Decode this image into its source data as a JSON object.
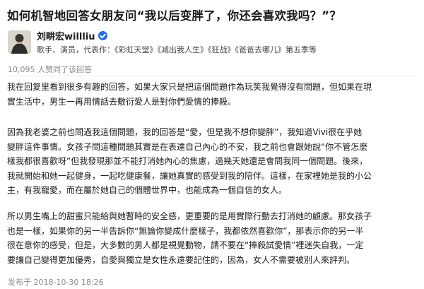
{
  "question": {
    "title": "如何机智地回答女朋友问“我以后变胖了，你还会喜欢我吗？”？"
  },
  "author": {
    "name": "刘畊宏willliu",
    "verified_icon": "verified-badge-icon",
    "bio": "歌手、演员，代表作：《彩虹天堂》《减出我人生》《狂战》《爸爸去哪儿》第五季等"
  },
  "likes_text": "10,095 人赞同了该回答",
  "answer": {
    "paragraphs": [
      [
        "我在回复里看到很多有趣的回答，如果大家只是把這個問題作為玩笑我覺得沒有問題，但如果在現",
        "實生活中，男生一再用情話去敷衍愛人是對你們愛情的捧殺。"
      ],
      [
        "因為我老婆之前也問過我這個問題，我的回答是“愛，但是我不想你變胖”，我知道Vivi很在乎她",
        "變胖這件事情。女孩子問這種問題其實是在表達自己內心的不安，我之前也會跟她說“你不管怎麼",
        "樣我都很喜歡呀”但我發現那並不能打消她內心的焦慮，過幾天她還是會問我同一個問題。後來，",
        "我就開始和她一起健身，一起吃健康餐，讓她真實的感受到我的陪伴。這樣，在家裡她是我的小公",
        "主，有我寵愛，而在屬於她自己的個體世界中，也能成為一個自信的女人。"
      ],
      [
        "所以男生嘴上的甜蜜只能給與她暫時的安全感，更重要的是用實際行動去打消她的顧慮。那女孩子",
        "也是一樣，如果你的另一半告訴你“無論你變成什麼樣子，我都依然喜歡你”，那表示你的另一半",
        "很在意你的感受，但是，大多數的男人都是視覺動物，請不要在“捧殺試愛情”裡迷失自我，一定",
        "要讓自己變得更加優秀，自愛與獨立是女性永遠要記住的，因為，女人不需要被別人來評判。"
      ]
    ]
  },
  "timestamp": "发布于 2018-10-30 18:26"
}
